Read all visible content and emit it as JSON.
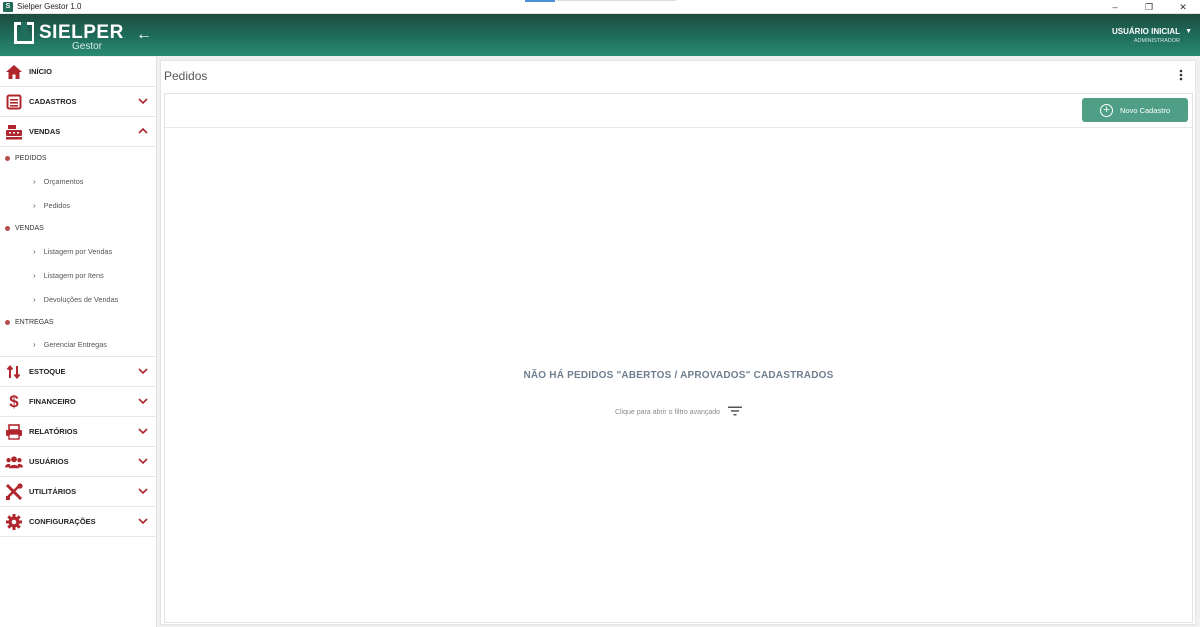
{
  "window": {
    "title": "Sielper Gestor 1.0",
    "minimize": "–",
    "restore": "❐",
    "close": "✕"
  },
  "header": {
    "brand": "SIELPER",
    "brand_sub": "Gestor",
    "back": "←",
    "user_name": "USUÁRIO INICIAL",
    "user_role": "ADMINISTRADOR",
    "user_caret": "▼"
  },
  "sidebar": {
    "inicio": "INÍCIO",
    "cadastros": "CADASTROS",
    "vendas": "VENDAS",
    "sections": [
      {
        "label": "PEDIDOS",
        "items": [
          "Orçamentos",
          "Pedidos"
        ]
      },
      {
        "label": "VENDAS",
        "items": [
          "Listagem por Vendas",
          "Listagem por Itens",
          "Devoluções de Vendas"
        ]
      },
      {
        "label": "ENTREGAS",
        "items": [
          "Gerenciar Entregas"
        ]
      }
    ],
    "estoque": "ESTOQUE",
    "financeiro": "FINANCEIRO",
    "relatorios": "RELATÓRIOS",
    "usuarios": "USUÁRIOS",
    "utilitarios": "UTILITÁRIOS",
    "configuracoes": "CONFIGURAÇÕES"
  },
  "main": {
    "title": "Pedidos",
    "new_button": "Novo Cadastro",
    "empty_message": "NÃO HÁ PEDIDOS \"ABERTOS / APROVADOS\" CADASTRADOS",
    "filter_hint": "Clique para abrir o filtro avançado"
  },
  "colors": {
    "accent": "#b0262d",
    "header": "#1f6e5c",
    "button": "#4f9f87"
  }
}
